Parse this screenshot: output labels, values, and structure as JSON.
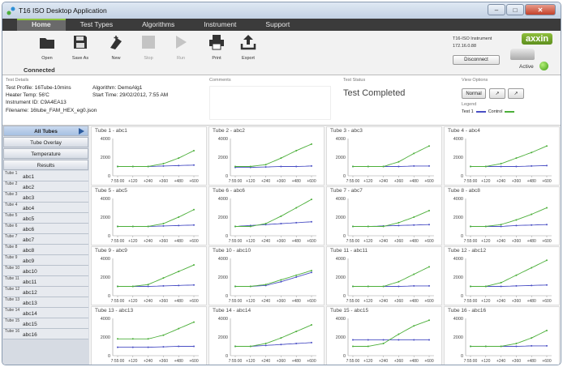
{
  "window": {
    "title": "T16 ISO Desktop Application"
  },
  "nav": {
    "tabs": [
      "Home",
      "Test Types",
      "Algorithms",
      "Instrument",
      "Support"
    ]
  },
  "ribbon": {
    "open": "Open",
    "save_as": "Save As",
    "new": "New",
    "stop": "Stop",
    "run": "Run",
    "print": "Print",
    "export": "Export",
    "connection_status": "Connected"
  },
  "instrument": {
    "name": "T16-ISO Instrument",
    "ip": "172.16.0.88",
    "disconnect_label": "Disconnect",
    "status": "Active",
    "logo": "axxin"
  },
  "details": {
    "section_label": "Test Details",
    "test_profile": "Test Profile: 16Tube-10mins",
    "heater_temp": "Heater Temp: 56'C",
    "instrument_id": "Instrument ID: C9A4EA13",
    "filename": "Filename: 16tube_FAM_HEX_eg0.json",
    "algorithm": "Algorithm: DemoAlg1",
    "start_time": "Start Time: 29/02/2012, 7:55 AM",
    "comments_label": "Comments",
    "status_label": "Test Status",
    "status_value": "Test Completed",
    "view_options_label": "View Options",
    "view_normal": "Normal",
    "legend_label": "Legend",
    "legend_test": "Test 1",
    "legend_control": "Control"
  },
  "sidebar": {
    "buttons": [
      "All Tubes",
      "Tube Overlay",
      "Temperature",
      "Results"
    ],
    "tubes": [
      {
        "num": "Tube 1",
        "label": "abc1"
      },
      {
        "num": "Tube 2",
        "label": "abc2"
      },
      {
        "num": "Tube 3",
        "label": "abc3"
      },
      {
        "num": "Tube 4",
        "label": "abc4"
      },
      {
        "num": "Tube 5",
        "label": "abc5"
      },
      {
        "num": "Tube 6",
        "label": "abc6"
      },
      {
        "num": "Tube 7",
        "label": "abc7"
      },
      {
        "num": "Tube 8",
        "label": "abc8"
      },
      {
        "num": "Tube 9",
        "label": "abc9"
      },
      {
        "num": "Tube 10",
        "label": "abc10"
      },
      {
        "num": "Tube 11",
        "label": "abc11"
      },
      {
        "num": "Tube 12",
        "label": "abc12"
      },
      {
        "num": "Tube 13",
        "label": "abc13"
      },
      {
        "num": "Tube 14",
        "label": "abc14"
      },
      {
        "num": "Tube 15",
        "label": "abc15"
      },
      {
        "num": "Tube 16",
        "label": "abc16"
      }
    ]
  },
  "colors": {
    "test": "#4a4fc4",
    "control": "#4caf3a"
  },
  "chart_data": [
    {
      "type": "line",
      "title": "Tube 1 - abc1",
      "x": [
        "7:55:00",
        "+120",
        "+240",
        "+360",
        "+480",
        "+600"
      ],
      "ylim": [
        0,
        4000
      ],
      "yticks": [
        0,
        2000,
        4000
      ],
      "series": [
        {
          "name": "Test 1",
          "values": [
            1000,
            1000,
            1000,
            1050,
            1100,
            1150
          ]
        },
        {
          "name": "Control",
          "values": [
            1000,
            1000,
            1000,
            1300,
            1900,
            2700
          ]
        }
      ]
    },
    {
      "type": "line",
      "title": "Tube 2 - abc2",
      "x": [
        "7:55:00",
        "+120",
        "+240",
        "+360",
        "+480",
        "+600"
      ],
      "ylim": [
        0,
        4000
      ],
      "yticks": [
        0,
        2000,
        4000
      ],
      "series": [
        {
          "name": "Test 1",
          "values": [
            900,
            900,
            950,
            1000,
            1000,
            1050
          ]
        },
        {
          "name": "Control",
          "values": [
            1000,
            1000,
            1200,
            1900,
            2700,
            3400
          ]
        }
      ]
    },
    {
      "type": "line",
      "title": "Tube 3 - abc3",
      "x": [
        "7:55:00",
        "+120",
        "+240",
        "+360",
        "+480",
        "+600"
      ],
      "ylim": [
        0,
        4000
      ],
      "yticks": [
        0,
        2000,
        4000
      ],
      "series": [
        {
          "name": "Test 1",
          "values": [
            1000,
            1000,
            1000,
            1000,
            1050,
            1050
          ]
        },
        {
          "name": "Control",
          "values": [
            1000,
            1000,
            1000,
            1500,
            2400,
            3200
          ]
        }
      ]
    },
    {
      "type": "line",
      "title": "Tube 4 - abc4",
      "x": [
        "7:55:00",
        "+120",
        "+240",
        "+360",
        "+480",
        "+600"
      ],
      "ylim": [
        0,
        4000
      ],
      "yticks": [
        0,
        2000,
        4000
      ],
      "series": [
        {
          "name": "Test 1",
          "values": [
            1000,
            1000,
            1000,
            1000,
            1050,
            1100
          ]
        },
        {
          "name": "Control",
          "values": [
            1000,
            1000,
            1300,
            1900,
            2500,
            3200
          ]
        }
      ]
    },
    {
      "type": "line",
      "title": "Tube 5 - abc5",
      "x": [
        "7:55:00",
        "+120",
        "+240",
        "+360",
        "+480",
        "+600"
      ],
      "ylim": [
        0,
        4000
      ],
      "yticks": [
        0,
        2000,
        4000
      ],
      "series": [
        {
          "name": "Test 1",
          "values": [
            1000,
            1000,
            1000,
            1050,
            1100,
            1150
          ]
        },
        {
          "name": "Control",
          "values": [
            1000,
            1000,
            1000,
            1300,
            2000,
            2800
          ]
        }
      ]
    },
    {
      "type": "line",
      "title": "Tube 6 - abc6",
      "x": [
        "7:55:00",
        "+120",
        "+240",
        "+360",
        "+480",
        "+600"
      ],
      "ylim": [
        0,
        4000
      ],
      "yticks": [
        0,
        2000,
        4000
      ],
      "series": [
        {
          "name": "Test 1",
          "values": [
            1000,
            1100,
            1200,
            1300,
            1400,
            1500
          ]
        },
        {
          "name": "Control",
          "values": [
            1000,
            1000,
            1300,
            2100,
            3000,
            3900
          ]
        }
      ]
    },
    {
      "type": "line",
      "title": "Tube 7 - abc7",
      "x": [
        "7:55:00",
        "+120",
        "+240",
        "+360",
        "+480",
        "+600"
      ],
      "ylim": [
        0,
        4000
      ],
      "yticks": [
        0,
        2000,
        4000
      ],
      "series": [
        {
          "name": "Test 1",
          "values": [
            1000,
            1000,
            1050,
            1100,
            1150,
            1200
          ]
        },
        {
          "name": "Control",
          "values": [
            1000,
            1000,
            1000,
            1400,
            2000,
            2700
          ]
        }
      ]
    },
    {
      "type": "line",
      "title": "Tube 8 - abc8",
      "x": [
        "7:55:00",
        "+120",
        "+240",
        "+360",
        "+480",
        "+600"
      ],
      "ylim": [
        0,
        4000
      ],
      "yticks": [
        0,
        2000,
        4000
      ],
      "series": [
        {
          "name": "Test 1",
          "values": [
            1000,
            1000,
            1000,
            1100,
            1150,
            1200
          ]
        },
        {
          "name": "Control",
          "values": [
            1000,
            1000,
            1200,
            1700,
            2300,
            3000
          ]
        }
      ]
    },
    {
      "type": "line",
      "title": "Tube 9 - abc9",
      "x": [
        "7:55:00",
        "+120",
        "+240",
        "+360",
        "+480",
        "+600"
      ],
      "ylim": [
        0,
        4000
      ],
      "yticks": [
        0,
        2000,
        4000
      ],
      "series": [
        {
          "name": "Test 1",
          "values": [
            1000,
            1000,
            1000,
            1050,
            1100,
            1150
          ]
        },
        {
          "name": "Control",
          "values": [
            1000,
            1000,
            1200,
            1900,
            2600,
            3300
          ]
        }
      ]
    },
    {
      "type": "line",
      "title": "Tube 10 - abc10",
      "x": [
        "7:55:00",
        "+120",
        "+240",
        "+360",
        "+480",
        "+600"
      ],
      "ylim": [
        0,
        4000
      ],
      "yticks": [
        0,
        2000,
        4000
      ],
      "series": [
        {
          "name": "Test 1",
          "values": [
            1000,
            1000,
            1100,
            1500,
            2000,
            2500
          ]
        },
        {
          "name": "Control",
          "values": [
            1000,
            1000,
            1200,
            1700,
            2200,
            2700
          ]
        }
      ]
    },
    {
      "type": "line",
      "title": "Tube 11 - abc11",
      "x": [
        "7:55:00",
        "+120",
        "+240",
        "+360",
        "+480",
        "+600"
      ],
      "ylim": [
        0,
        4000
      ],
      "yticks": [
        0,
        2000,
        4000
      ],
      "series": [
        {
          "name": "Test 1",
          "values": [
            1000,
            1000,
            1000,
            1000,
            1050,
            1050
          ]
        },
        {
          "name": "Control",
          "values": [
            1000,
            1000,
            1000,
            1500,
            2300,
            3100
          ]
        }
      ]
    },
    {
      "type": "line",
      "title": "Tube 12 - abc12",
      "x": [
        "7:55:00",
        "+120",
        "+240",
        "+360",
        "+480",
        "+600"
      ],
      "ylim": [
        0,
        4000
      ],
      "yticks": [
        0,
        2000,
        4000
      ],
      "series": [
        {
          "name": "Test 1",
          "values": [
            1000,
            1000,
            1000,
            1050,
            1100,
            1150
          ]
        },
        {
          "name": "Control",
          "values": [
            1000,
            1000,
            1400,
            2200,
            3000,
            3800
          ]
        }
      ]
    },
    {
      "type": "line",
      "title": "Tube 13 - abc13",
      "x": [
        "7:55:00",
        "+120",
        "+240",
        "+360",
        "+480",
        "+600"
      ],
      "ylim": [
        0,
        4000
      ],
      "yticks": [
        0,
        2000,
        4000
      ],
      "series": [
        {
          "name": "Test 1",
          "values": [
            900,
            900,
            900,
            950,
            1000,
            1000
          ]
        },
        {
          "name": "Control",
          "values": [
            1800,
            1800,
            1800,
            2200,
            2900,
            3600
          ]
        }
      ]
    },
    {
      "type": "line",
      "title": "Tube 14 - abc14",
      "x": [
        "7:55:00",
        "+120",
        "+240",
        "+360",
        "+480",
        "+600"
      ],
      "ylim": [
        0,
        4000
      ],
      "yticks": [
        0,
        2000,
        4000
      ],
      "series": [
        {
          "name": "Test 1",
          "values": [
            1000,
            1000,
            1100,
            1200,
            1300,
            1400
          ]
        },
        {
          "name": "Control",
          "values": [
            1000,
            1000,
            1300,
            1900,
            2600,
            3300
          ]
        }
      ]
    },
    {
      "type": "line",
      "title": "Tube 15 - abc15",
      "x": [
        "7:55:00",
        "+120",
        "+240",
        "+360",
        "+480",
        "+600"
      ],
      "ylim": [
        0,
        4000
      ],
      "yticks": [
        0,
        2000,
        4000
      ],
      "series": [
        {
          "name": "Test 1",
          "values": [
            1700,
            1700,
            1700,
            1700,
            1700,
            1700
          ]
        },
        {
          "name": "Control",
          "values": [
            1000,
            1000,
            1300,
            2300,
            3200,
            3800
          ]
        }
      ]
    },
    {
      "type": "line",
      "title": "Tube 16 - abc16",
      "x": [
        "7:55:00",
        "+120",
        "+240",
        "+360",
        "+480",
        "+600"
      ],
      "ylim": [
        0,
        4000
      ],
      "yticks": [
        0,
        2000,
        4000
      ],
      "series": [
        {
          "name": "Test 1",
          "values": [
            1000,
            1000,
            1000,
            1000,
            1050,
            1050
          ]
        },
        {
          "name": "Control",
          "values": [
            1000,
            1000,
            1000,
            1300,
            1900,
            2700
          ]
        }
      ]
    }
  ]
}
